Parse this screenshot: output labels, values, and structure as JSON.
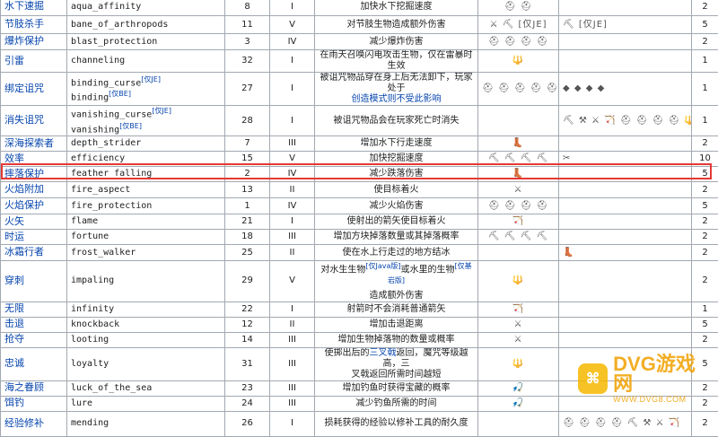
{
  "table": {
    "rows": [
      {
        "name": "水下速掘",
        "id": "aqua_affinity",
        "max": "8",
        "level": "I",
        "desc": "加快水下挖掘速度",
        "items": "⛑ ⛑",
        "extra": "",
        "weight": "2",
        "h": 20
      },
      {
        "name": "节肢杀手",
        "id": "bane_of_arthropods",
        "max": "11",
        "level": "V",
        "desc": "对节肢生物造成额外伤害",
        "items": "⚔ ⛏ [仅JE]",
        "extra": "⛏ [仅JE]",
        "weight": "5",
        "h": 20
      },
      {
        "name": "爆炸保护",
        "id": "blast_protection",
        "max": "3",
        "level": "IV",
        "desc": "减少爆炸伤害",
        "items": "⛑ ⛑ ⛑ ⛑",
        "extra": "",
        "weight": "2",
        "h": 18
      },
      {
        "name": "引雷",
        "id": "channeling",
        "max": "32",
        "level": "I",
        "desc": "在雨天召唤闪电攻击生物，仅在雷暴时生效",
        "items": "🔱",
        "extra": "",
        "weight": "1",
        "h": 18
      },
      {
        "name": "绑定诅咒",
        "id": "binding_curse",
        "id2": "binding",
        "tag1": "[仅JE]",
        "tag2": "[仅BE]",
        "max": "27",
        "level": "I",
        "desc": "被诅咒物品穿在身上后无法卸下，玩家处于",
        "desc2": "创造模式则不受此影响",
        "items": "⛑ ⛑ ⛑ ⛑ ⛑",
        "extra": "◆ ◆ ◆ ◆",
        "weight": "1",
        "h": 32
      },
      {
        "name": "消失诅咒",
        "id": "vanishing_curse",
        "id2": "vanishing",
        "tag1": "[仅JE]",
        "tag2": "[仅BE]",
        "max": "28",
        "level": "I",
        "desc": "被诅咒物品会在玩家死亡时消失",
        "items": "",
        "extra": "⛏ ⚒ ⚔ 🏹 ⛑ ⛑ ⛑ ⛑ 🔱 🎣",
        "weight": "1",
        "h": 34
      },
      {
        "name": "深海探索者",
        "id": "depth_strider",
        "max": "7",
        "level": "III",
        "desc": "增加水下行走速度",
        "items": "👢",
        "extra": "",
        "weight": "2",
        "h": 17
      },
      {
        "name": "效率",
        "id": "efficiency",
        "max": "15",
        "level": "V",
        "desc": "加快挖掘速度",
        "items": "⛏ ⛏ ⛏ ⛏",
        "extra": "✂",
        "weight": "10",
        "h": 17
      },
      {
        "name": "摔落保护",
        "id": "feather_falling",
        "max": "2",
        "level": "IV",
        "desc": "减少跌落伤害",
        "items": "👢",
        "extra": "",
        "weight": "5",
        "h": 17
      },
      {
        "name": "火焰附加",
        "id": "fire_aspect",
        "max": "13",
        "level": "II",
        "desc": "使目标着火",
        "items": "⚔",
        "extra": "",
        "weight": "2",
        "h": 18
      },
      {
        "name": "火焰保护",
        "id": "fire_protection",
        "max": "1",
        "level": "IV",
        "desc": "减少火焰伤害",
        "items": "⛑ ⛑ ⛑ ⛑",
        "extra": "",
        "weight": "5",
        "h": 18
      },
      {
        "name": "火矢",
        "id": "flame",
        "max": "21",
        "level": "I",
        "desc": "使射出的箭矢使目标着火",
        "items": "🏹",
        "extra": "",
        "weight": "2",
        "h": 17
      },
      {
        "name": "时运",
        "id": "fortune",
        "max": "18",
        "level": "III",
        "desc": "增加方块掉落数量或其掉落概率",
        "items": "⛏ ⛏ ⛏ ⛏",
        "extra": "",
        "weight": "2",
        "h": 17
      },
      {
        "name": "冰霜行者",
        "id": "frost_walker",
        "max": "25",
        "level": "II",
        "desc": "使在水上行走过的地方结冰",
        "items": "",
        "extra": "👢",
        "weight": "2",
        "h": 18
      },
      {
        "name": "穿刺",
        "id": "impaling",
        "max": "29",
        "level": "V",
        "desc": "对水生生物",
        "desc_tag": "[仅Java版]",
        "desc_mid": "或水里的生物",
        "desc_tag2": "[仅基岩版]",
        "desc2": "造成额外伤害",
        "items": "🔱",
        "extra": "",
        "weight": "2",
        "h": 33
      },
      {
        "name": "无限",
        "id": "infinity",
        "max": "22",
        "level": "I",
        "desc": "射箭时不会消耗普通箭矢",
        "items": "🏹",
        "extra": "",
        "weight": "1",
        "h": 17
      },
      {
        "name": "击退",
        "id": "knockback",
        "max": "12",
        "level": "II",
        "desc": "增加击退距离",
        "items": "⚔",
        "extra": "",
        "weight": "5",
        "h": 17
      },
      {
        "name": "抢夺",
        "id": "looting",
        "max": "14",
        "level": "III",
        "desc": "增加生物掉落物的数量或概率",
        "items": "⚔",
        "extra": "",
        "weight": "2",
        "h": 17
      },
      {
        "name": "忠诚",
        "id": "loyalty",
        "max": "31",
        "level": "III",
        "desc": "使掷出后的",
        "desc_link": "三叉戟",
        "desc_mid": "返回，魔咒等级越高，三",
        "desc2": "叉戟返回所需时间越短",
        "items": "🔱",
        "extra": "",
        "weight": "5",
        "h": 36
      },
      {
        "name": "海之眷顾",
        "id": "luck_of_the_sea",
        "max": "23",
        "level": "III",
        "desc": "增加钓鱼时获得宝藏的概率",
        "items": "🎣",
        "extra": "",
        "weight": "2",
        "h": 17
      },
      {
        "name": "饵钓",
        "id": "lure",
        "max": "24",
        "level": "III",
        "desc": "减少钓鱼所需的时间",
        "items": "🎣",
        "extra": "",
        "weight": "2",
        "h": 17
      },
      {
        "name": "经验修补",
        "id": "mending",
        "max": "26",
        "level": "I",
        "desc": "损耗获得的经验以修补工具的耐久度",
        "items": "",
        "extra": "⛑ ⛑ ⛑ ⛑ ⛏ ⚒ ⚔ 🏹",
        "weight": "2",
        "h": 28
      }
    ]
  },
  "watermark": {
    "name": "DVG游戏网",
    "url": "WWW.DVG8.COM"
  }
}
